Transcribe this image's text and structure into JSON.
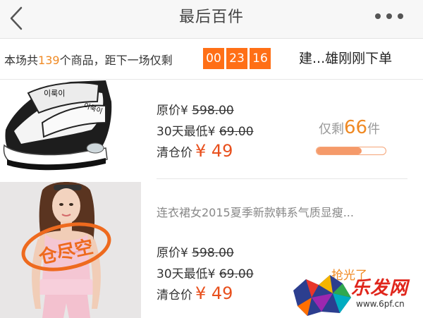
{
  "header": {
    "title": "最后百件",
    "back_icon": "chevron-left-icon",
    "more_icon": "more-horizontal-icon"
  },
  "info_bar": {
    "prefix": "本场共",
    "count": "139",
    "suffix": "个商品，距下一场仅剩",
    "timer": {
      "hours": "00",
      "minutes": "23",
      "seconds": "16"
    },
    "ticker": "建...雄刚刚下单"
  },
  "products": [
    {
      "orig_label": "原价¥ ",
      "orig_price": "598.00",
      "low_label": "30天最低¥ ",
      "low_price": "69.00",
      "clear_label": "清仓价",
      "clear_price": "¥ 49",
      "remain_prefix": "仅剩",
      "remain_count": "66",
      "remain_suffix": "件",
      "stock_fraction": 0.65,
      "image_text": [
        "이룩이",
        "이룩이"
      ]
    },
    {
      "title": "连衣裙女2015夏季新款韩系气质显瘦...",
      "orig_label": "原价¥ ",
      "orig_price": "598.00",
      "low_label": "30天最低¥ ",
      "low_price": "69.00",
      "clear_label": "清仓价",
      "clear_price": "¥ 49",
      "stamp": "仓尽空",
      "action": "抢光了"
    }
  ],
  "watermark": {
    "text": "乐发网",
    "url": "www.6pf.cn"
  },
  "colors": {
    "accent": "#ff6f16",
    "price": "#e8501d",
    "count": "#f08a24"
  }
}
